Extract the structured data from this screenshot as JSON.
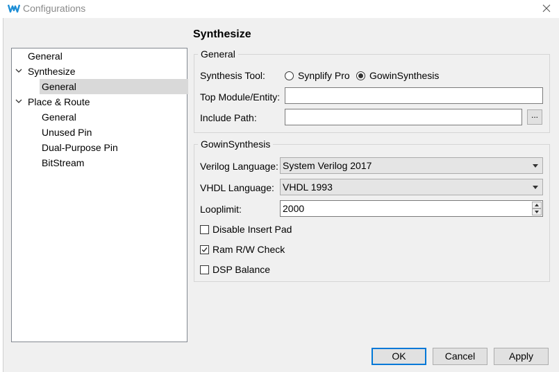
{
  "window": {
    "title": "Configurations"
  },
  "tree": {
    "items": [
      {
        "label": "General",
        "indent": 0,
        "expander": ""
      },
      {
        "label": "Synthesize",
        "indent": 0,
        "expander": "expanded"
      },
      {
        "label": "General",
        "indent": 1,
        "expander": "",
        "selected": true
      },
      {
        "label": "Place & Route",
        "indent": 0,
        "expander": "expanded"
      },
      {
        "label": "General",
        "indent": 1,
        "expander": ""
      },
      {
        "label": "Unused Pin",
        "indent": 1,
        "expander": ""
      },
      {
        "label": "Dual-Purpose Pin",
        "indent": 1,
        "expander": ""
      },
      {
        "label": "BitStream",
        "indent": 1,
        "expander": ""
      }
    ]
  },
  "page": {
    "title": "Synthesize"
  },
  "general_group": {
    "legend": "General",
    "synthesis_tool_label": "Synthesis Tool:",
    "synthesis_tool_options": [
      {
        "label": "Synplify Pro",
        "checked": false
      },
      {
        "label": "GowinSynthesis",
        "checked": true
      }
    ],
    "top_module_label": "Top Module/Entity:",
    "top_module_value": "",
    "include_path_label": "Include Path:",
    "include_path_value": "",
    "browse_label": "..."
  },
  "gowin_group": {
    "legend": "GowinSynthesis",
    "verilog_label": "Verilog Language:",
    "verilog_value": "System Verilog 2017",
    "vhdl_label": "VHDL Language:",
    "vhdl_value": "VHDL 1993",
    "looplimit_label": "Looplimit:",
    "looplimit_value": "2000",
    "checkboxes": [
      {
        "label": "Disable Insert Pad",
        "checked": false
      },
      {
        "label": "Ram R/W Check",
        "checked": true
      },
      {
        "label": "DSP Balance",
        "checked": false
      }
    ]
  },
  "buttons": {
    "ok": "OK",
    "cancel": "Cancel",
    "apply": "Apply"
  },
  "colors": {
    "accent": "#0078d7",
    "selection": "#d9d9d9",
    "background": "#f0f0f0"
  }
}
